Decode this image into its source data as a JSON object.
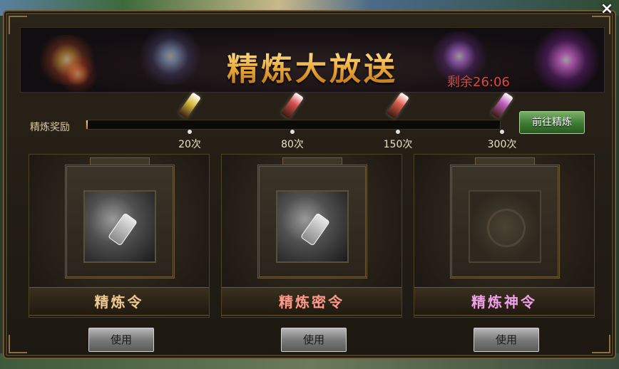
{
  "dialog": {
    "title": "精炼大放送",
    "timer": "剩余26:06",
    "close_label": "×"
  },
  "progress": {
    "label": "精炼奖励",
    "fill_fraction": 0.004,
    "milestones": [
      {
        "label": "20次",
        "gem_color": "#d8c040"
      },
      {
        "label": "80次",
        "gem_color": "#d85050"
      },
      {
        "label": "150次",
        "gem_color": "#e06050"
      },
      {
        "label": "300次",
        "gem_color": "#c060c0"
      }
    ],
    "go_button": "前往精炼"
  },
  "cards": [
    {
      "name": "精炼令",
      "name_color": "#f0c890",
      "use_label": "使用",
      "state": "stone"
    },
    {
      "name": "精炼密令",
      "name_color": "#ff9a8a",
      "use_label": "使用",
      "state": "stone"
    },
    {
      "name": "精炼神令",
      "name_color": "#f0a0e8",
      "use_label": "使用",
      "state": "empty"
    }
  ]
}
